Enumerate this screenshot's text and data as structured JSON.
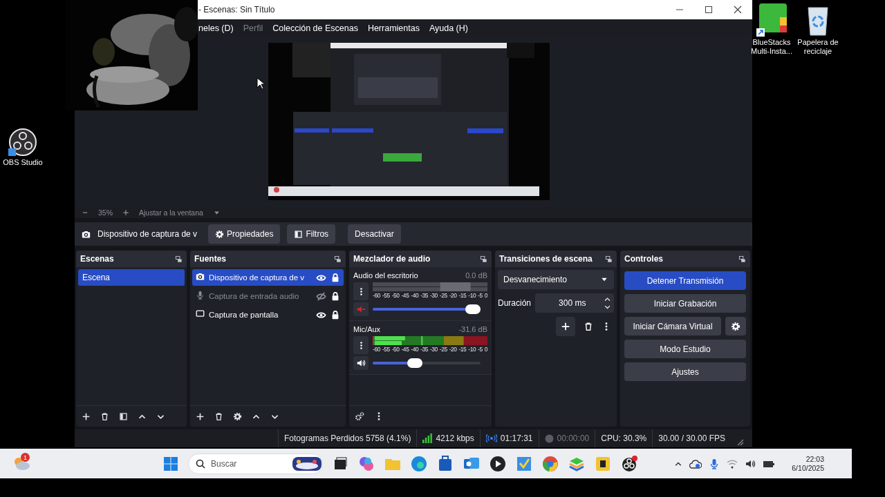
{
  "desktop_icons": [
    {
      "kind": "obs",
      "label": "OBS Studio"
    },
    {
      "kind": "bluestacks",
      "label": "BlueStacks Multi-Insta..."
    },
    {
      "kind": "recycle",
      "label": "Papelera de reciclaje"
    }
  ],
  "window": {
    "title": "- Escenas: Sin Título"
  },
  "menu": [
    {
      "label": "neles (D)",
      "disabled": false
    },
    {
      "label": "Perfil",
      "disabled": true
    },
    {
      "label": "Colección de Escenas",
      "disabled": false
    },
    {
      "label": "Herramientas",
      "disabled": false
    },
    {
      "label": "Ayuda (H)",
      "disabled": false
    }
  ],
  "preview": {
    "zoom": "35%",
    "fit": "Ajustar a la ventana"
  },
  "source_bar": {
    "name": "Dispositivo de captura de v",
    "buttons": [
      {
        "kind": "gear",
        "label": "Propiedades"
      },
      {
        "kind": "filter",
        "label": "Filtros"
      },
      {
        "kind": "plain",
        "label": "Desactivar"
      }
    ]
  },
  "scenes": {
    "title": "Escenas",
    "items": [
      {
        "label": "Escena",
        "selected": true
      }
    ]
  },
  "sources": {
    "title": "Fuentes",
    "items": [
      {
        "kind": "camera",
        "label": "Dispositivo de captura de v",
        "visible": true,
        "selected": true
      },
      {
        "kind": "mic",
        "label": "Captura de entrada audio",
        "visible": false,
        "selected": false
      },
      {
        "kind": "monitor",
        "label": "Captura de pantalla",
        "visible": true,
        "selected": false
      }
    ]
  },
  "mixer": {
    "title": "Mezclador de audio",
    "channels": [
      {
        "name": "Audio del escritorio",
        "reading": "0.0 dB",
        "muted": true,
        "level": 1.0,
        "scale": [
          "-60",
          "-55",
          "-50",
          "-45",
          "-40",
          "-35",
          "-30",
          "-25",
          "-20",
          "-15",
          "-10",
          "-5",
          "0"
        ]
      },
      {
        "name": "Mic/Aux",
        "reading": "-31.6 dB",
        "muted": false,
        "level": 0.37,
        "scale": [
          "-60",
          "-55",
          "-50",
          "-45",
          "-40",
          "-35",
          "-30",
          "-25",
          "-20",
          "-15",
          "-10",
          "-5",
          "0"
        ]
      }
    ]
  },
  "transitions": {
    "title": "Transiciones de escena",
    "transition": "Desvanecimiento",
    "duration_label": "Duración",
    "duration": "300 ms"
  },
  "controls": {
    "title": "Controles",
    "buttons": [
      {
        "kind": "plain",
        "label": "Detener Transmisión",
        "active": true
      },
      {
        "kind": "plain",
        "label": "Iniciar Grabación",
        "active": false
      },
      {
        "kind": "with_settings",
        "label": "Iniciar Cámara Virtual",
        "active": false
      },
      {
        "kind": "plain",
        "label": "Modo Estudio",
        "active": false
      },
      {
        "kind": "plain",
        "label": "Ajustes",
        "active": false
      }
    ]
  },
  "status_bar": {
    "dropped": "Fotogramas Perdidos 5758 (4.1%)",
    "bitrate": "4212 kbps",
    "streaming": true,
    "stream_time": "01:17:31",
    "recording": false,
    "record_time": "00:00:00",
    "cpu": "CPU: 30.3%",
    "fps": "30.00 / 30.00 FPS"
  },
  "taskbar": {
    "badge": "1",
    "search_placeholder": "Buscar",
    "time": "22:03",
    "date": "6/10/2025"
  }
}
